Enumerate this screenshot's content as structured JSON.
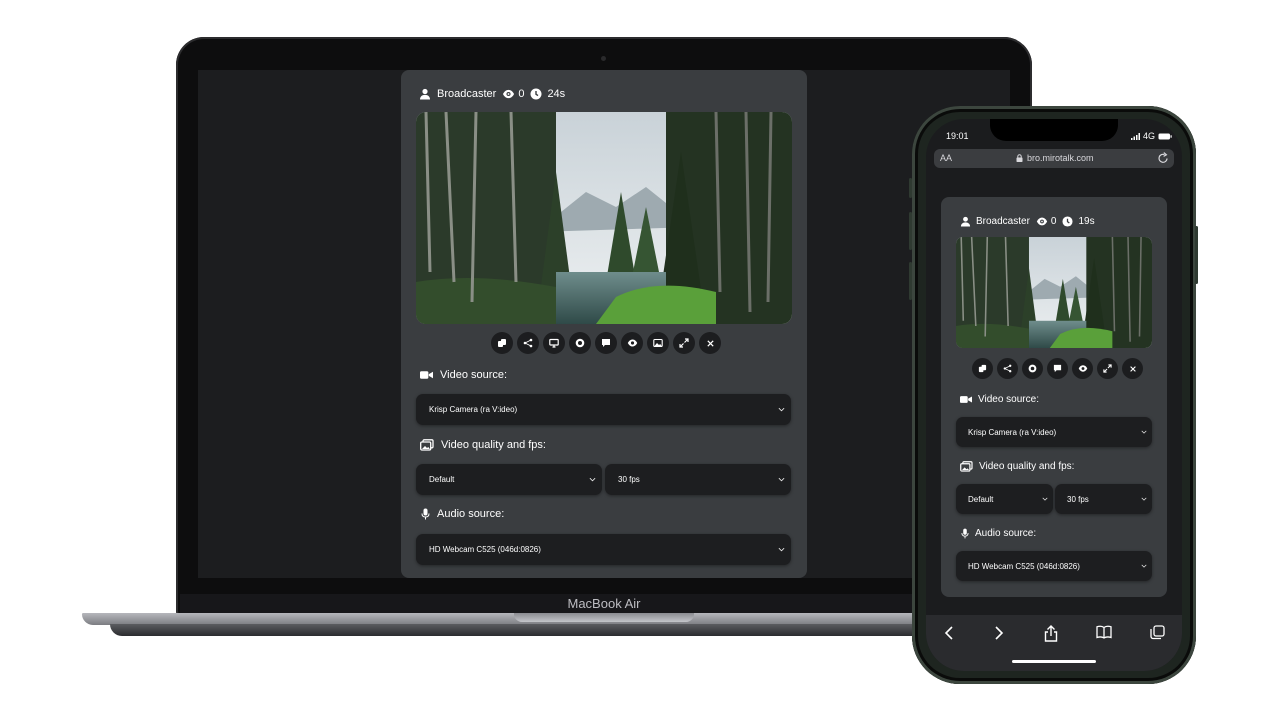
{
  "laptop": {
    "brand_label": "MacBook Air",
    "app": {
      "header": {
        "role": "Broadcaster",
        "viewers": "0",
        "duration": "24s"
      },
      "video_alt": "Forest lake scene",
      "controls": [
        {
          "name": "copy-icon"
        },
        {
          "name": "share-icon"
        },
        {
          "name": "screen-share-icon"
        },
        {
          "name": "record-icon"
        },
        {
          "name": "chat-icon"
        },
        {
          "name": "eye-icon"
        },
        {
          "name": "picture-icon"
        },
        {
          "name": "fullscreen-icon"
        },
        {
          "name": "close-icon"
        }
      ],
      "video_source_label": "Video source:",
      "video_source_value": "Krisp Camera (ra V:ideo)",
      "video_quality_label": "Video quality and fps:",
      "video_quality_value": "Default",
      "video_fps_value": "30 fps",
      "audio_source_label": "Audio source:",
      "audio_source_value": "HD Webcam C525 (046d:0826)"
    }
  },
  "phone": {
    "status": {
      "time": "19:01",
      "network": "4G"
    },
    "browser": {
      "text_size": "AA",
      "url": "bro.mirotalk.com"
    },
    "app": {
      "header": {
        "role": "Broadcaster",
        "viewers": "0",
        "duration": "19s"
      },
      "video_alt": "Forest lake scene",
      "controls": [
        {
          "name": "copy-icon"
        },
        {
          "name": "share-icon"
        },
        {
          "name": "record-icon"
        },
        {
          "name": "chat-icon"
        },
        {
          "name": "eye-icon"
        },
        {
          "name": "fullscreen-icon"
        },
        {
          "name": "close-icon"
        }
      ],
      "video_source_label": "Video source:",
      "video_source_value": "Krisp Camera (ra V:ideo)",
      "video_quality_label": "Video quality and fps:",
      "video_quality_value": "Default",
      "video_fps_value": "30 fps",
      "audio_source_label": "Audio source:",
      "audio_source_value": "HD Webcam C525 (046d:0826)"
    },
    "toolbar": [
      "back-icon",
      "forward-icon",
      "share-icon",
      "bookmarks-icon",
      "tabs-icon"
    ]
  },
  "colors": {
    "panel": "#3a3d40",
    "select": "#1d1e20",
    "screen_bg": "#1c1d1f",
    "accent_grass": "#5aa03a"
  }
}
